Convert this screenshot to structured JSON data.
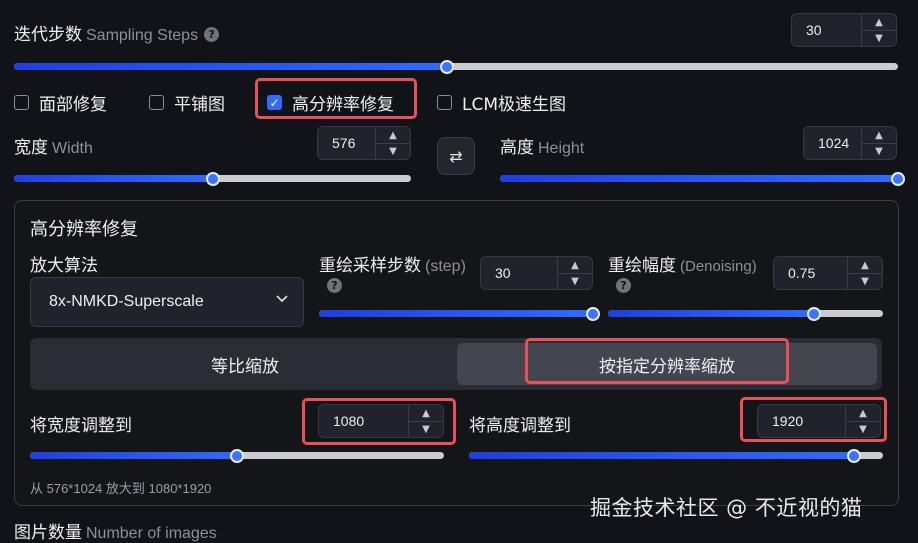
{
  "steps": {
    "label": "迭代步数",
    "sub": "Sampling Steps",
    "help": "?",
    "value": "30",
    "fraction": 0.49
  },
  "checks": [
    {
      "label": "面部修复",
      "checked": false
    },
    {
      "label": "平铺图",
      "checked": false
    },
    {
      "label": "高分辨率修复",
      "checked": true
    },
    {
      "label": "LCM极速生图",
      "checked": false
    }
  ],
  "checkmark": "✓",
  "width": {
    "label": "宽度",
    "sub": "Width",
    "value": "576",
    "fraction": 0.5
  },
  "height": {
    "label": "高度",
    "sub": "Height",
    "value": "1024",
    "fraction": 1.0
  },
  "swap_icon": "⇄",
  "hires": {
    "title": "高分辨率修复",
    "upscaler": {
      "label": "放大算法",
      "value": "8x-NMKD-Superscale"
    },
    "steps": {
      "label": "重绘采样步数",
      "sub": "(step)",
      "help": "?",
      "value": "30",
      "fraction": 1.0
    },
    "denoise": {
      "label": "重绘幅度",
      "sub": "(Denoising)",
      "help": "?",
      "value": "0.75",
      "fraction": 0.75
    },
    "modes": [
      "等比缩放",
      "按指定分辨率缩放"
    ],
    "active_mode": 1,
    "resize_w": {
      "label": "将宽度调整到",
      "value": "1080",
      "fraction": 0.5
    },
    "resize_h": {
      "label": "将高度调整到",
      "value": "1920",
      "fraction": 0.93
    },
    "summary": "从 576*1024 放大到 1080*1920"
  },
  "images": {
    "label": "图片数量",
    "sub": "Number of images"
  },
  "watermark": "掘金技术社区 @ 不近视的猫",
  "colors": {
    "accent": "#2f6bff",
    "highlight": "#e8505b",
    "background": "#111318"
  }
}
